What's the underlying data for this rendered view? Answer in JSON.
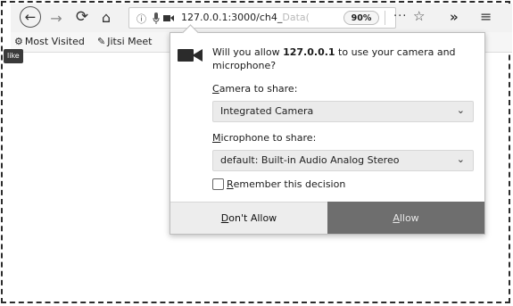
{
  "toolbar": {
    "url_main": "127.0.0.1:3000/ch4_",
    "url_faded": "Data(",
    "zoom": "90%",
    "more_glyph": "···"
  },
  "bookmarks": [
    {
      "icon": "gear-icon",
      "label": "Most Visited"
    },
    {
      "icon": "brush-icon",
      "label": "Jitsi Meet"
    }
  ],
  "tooltip": {
    "text": "like"
  },
  "popup": {
    "message_prefix": "Will you allow ",
    "message_host": "127.0.0.1",
    "message_suffix": " to use your camera and microphone?",
    "camera_label_first": "C",
    "camera_label_rest": "amera to share:",
    "camera_value": "Integrated Camera",
    "mic_label_first": "M",
    "mic_label_rest": "icrophone to share:",
    "mic_value": "default: Built-in Audio Analog Stereo",
    "remember_first": "R",
    "remember_rest": "emember this decision",
    "remember_checked": false,
    "deny_first": "D",
    "deny_rest": "on't Allow",
    "allow_first": "A",
    "allow_rest": "llow",
    "colors": {
      "allow_bg": "#6e6e6e",
      "deny_bg": "#ededed",
      "select_bg": "#ebebeb"
    }
  }
}
